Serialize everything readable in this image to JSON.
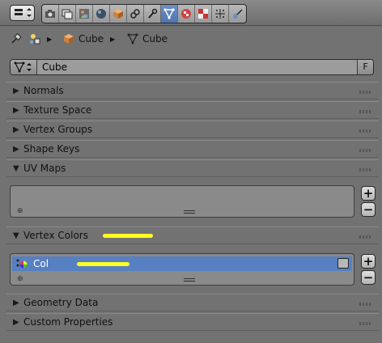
{
  "toolbar": {
    "editor_type_icon": "properties-editor-icon",
    "tabs": [
      {
        "id": "render",
        "icon": "camera-icon"
      },
      {
        "id": "render-layers",
        "icon": "layers-icon"
      },
      {
        "id": "scene",
        "icon": "scene-icon"
      },
      {
        "id": "world",
        "icon": "world-icon"
      },
      {
        "id": "object",
        "icon": "cube-object-icon"
      },
      {
        "id": "constraints",
        "icon": "constraint-icon"
      },
      {
        "id": "modifiers",
        "icon": "wrench-icon"
      },
      {
        "id": "data",
        "icon": "mesh-data-icon",
        "active": true
      },
      {
        "id": "material",
        "icon": "material-icon"
      },
      {
        "id": "texture",
        "icon": "texture-icon"
      },
      {
        "id": "particles",
        "icon": "particles-icon"
      },
      {
        "id": "physics",
        "icon": "physics-icon"
      }
    ]
  },
  "breadcrumb": {
    "object_label": "Cube",
    "mesh_label": "Cube"
  },
  "datablock": {
    "name": "Cube",
    "fake_user": "F"
  },
  "panels": {
    "normals": "Normals",
    "texture_space": "Texture Space",
    "vertex_groups": "Vertex Groups",
    "shape_keys": "Shape Keys",
    "uv_maps": "UV Maps",
    "vertex_colors": "Vertex Colors",
    "geometry_data": "Geometry Data",
    "custom_properties": "Custom Properties"
  },
  "vertex_colors_list": {
    "items": [
      {
        "name": "Col"
      }
    ]
  },
  "buttons": {
    "add": "+",
    "remove": "−"
  },
  "colors": {
    "background": "#727272",
    "active_tab": "#5680c2",
    "selected_row": "#5680c2",
    "highlight_marker": "#ffff20"
  }
}
